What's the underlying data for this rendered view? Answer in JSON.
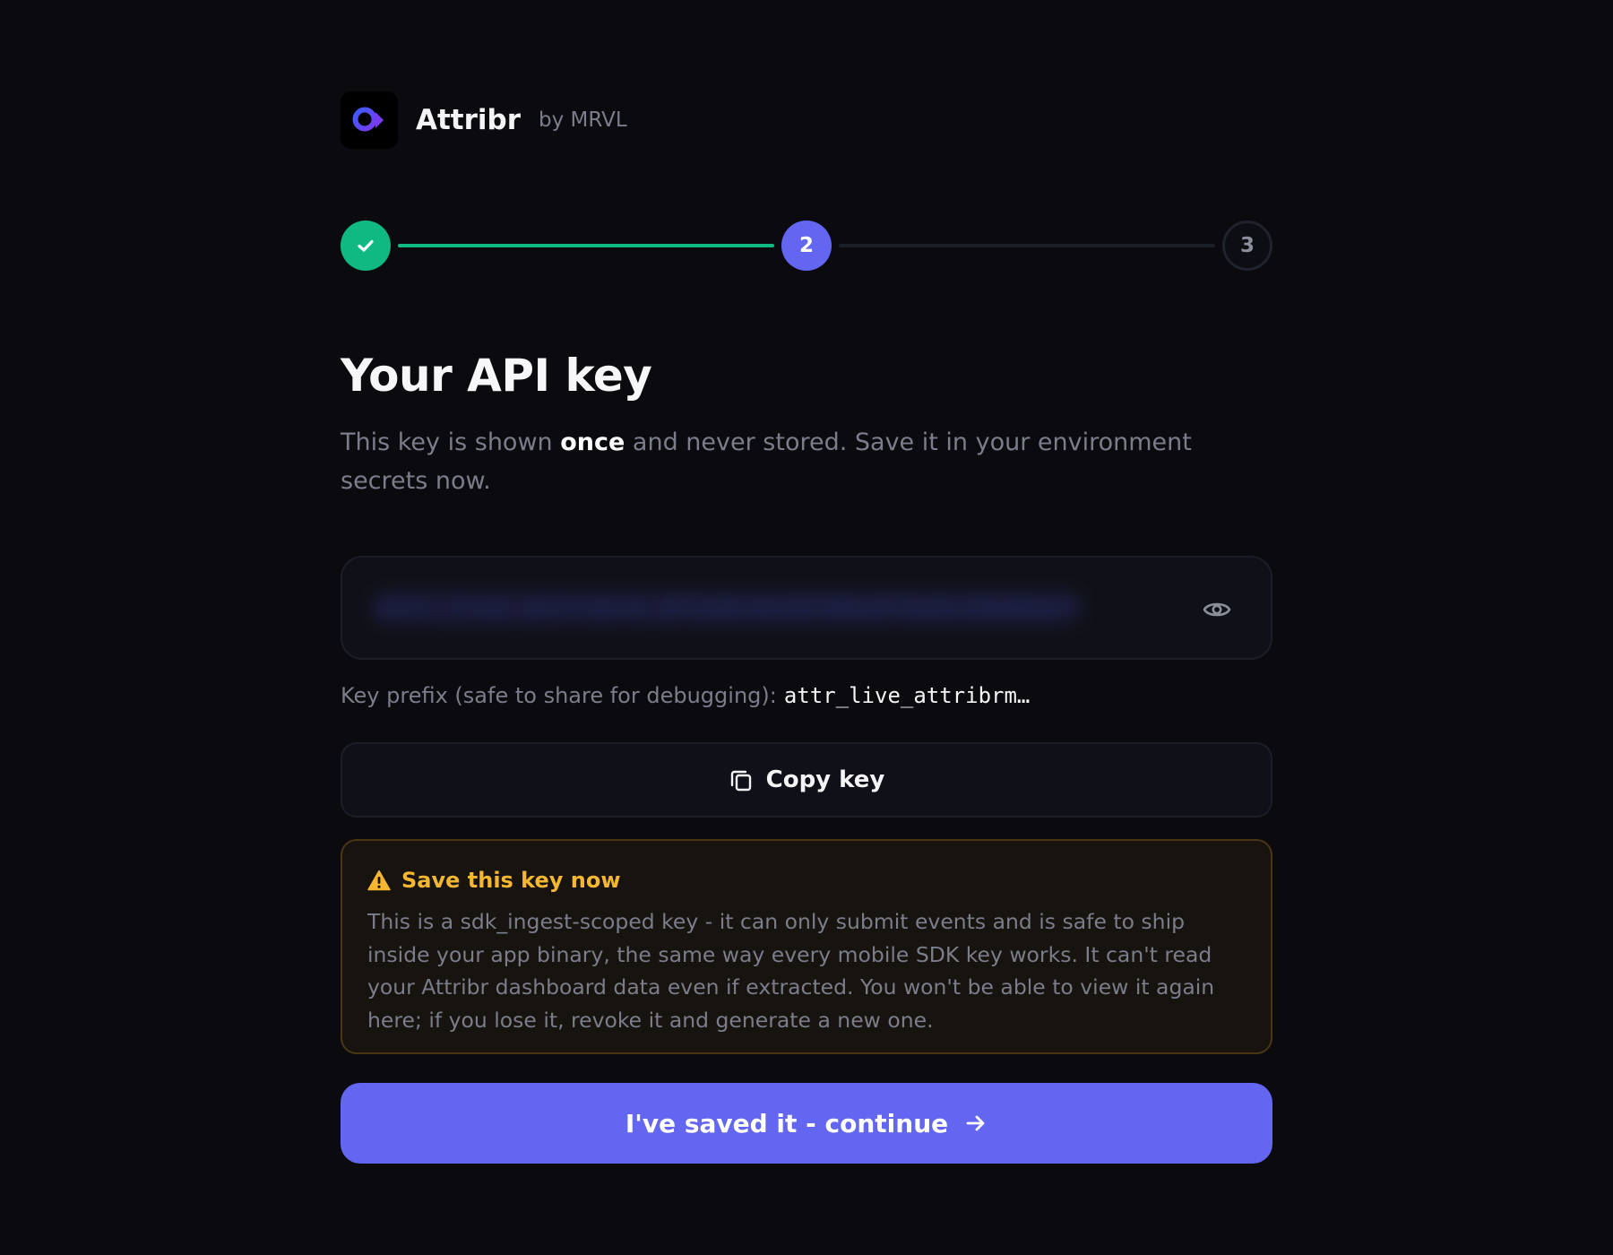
{
  "brand": {
    "name": "Attribr",
    "by": "by MRVL"
  },
  "stepper": {
    "steps": [
      {
        "state": "completed",
        "label": ""
      },
      {
        "state": "current",
        "label": "2"
      },
      {
        "state": "upcoming",
        "label": "3"
      }
    ]
  },
  "page": {
    "title": "Your API key",
    "description_before": "This key is shown ",
    "description_emphasis": "once",
    "description_after": " and never stored. Save it in your environment secrets now."
  },
  "key_field": {
    "masked_value": "attr_live_attribrm_8f2a9c4e1b7d6a3f5e9c2b8d4a7f1e6c3b9"
  },
  "prefix": {
    "label": "Key prefix (safe to share for debugging):",
    "value": "attr_live_attribrm…"
  },
  "copy_button": {
    "label": "Copy key"
  },
  "warning": {
    "title": "Save this key now",
    "body": "This is a sdk_ingest-scoped key - it can only submit events and is safe to ship inside your app binary, the same way every mobile SDK key works. It can't read your Attribr dashboard data even if extracted. You won't be able to view it again here; if you lose it, revoke it and generate a new one."
  },
  "continue_button": {
    "label": "I've saved it - continue"
  },
  "colors": {
    "background": "#0a0a0f",
    "accent": "#6366f1",
    "success": "#10b981",
    "warning": "#f5b731"
  },
  "icons": {
    "logo": "attribr-logo-icon",
    "check": "check-icon",
    "eye": "eye-icon",
    "copy": "copy-icon",
    "warning": "warning-triangle-icon",
    "arrow": "arrow-right-icon"
  }
}
